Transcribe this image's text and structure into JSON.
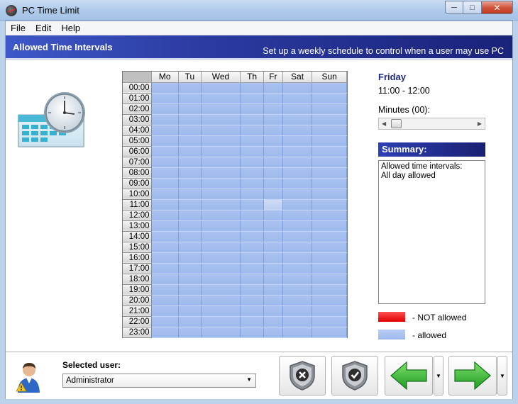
{
  "window": {
    "title": "PC Time Limit"
  },
  "window_buttons": {
    "min": "0",
    "max": "1",
    "close": "r"
  },
  "menu": {
    "items": [
      "File",
      "Edit",
      "Help"
    ]
  },
  "header": {
    "title": "Allowed Time Intervals",
    "subtitle": "Set up a weekly schedule to control when a user may use PC"
  },
  "schedule": {
    "days": [
      "Mo",
      "Tu",
      "Wed",
      "Th",
      "Fr",
      "Sat",
      "Sun"
    ],
    "hours": [
      "00:00",
      "01:00",
      "02:00",
      "03:00",
      "04:00",
      "05:00",
      "06:00",
      "07:00",
      "08:00",
      "09:00",
      "10:00",
      "11:00",
      "12:00",
      "13:00",
      "14:00",
      "15:00",
      "16:00",
      "17:00",
      "18:00",
      "19:00",
      "20:00",
      "21:00",
      "22:00",
      "23:00"
    ],
    "selected": {
      "day": "Fr",
      "hour": "11:00"
    }
  },
  "details": {
    "day": "Friday",
    "time_range": "11:00 - 12:00",
    "minutes_label": "Minutes (00):"
  },
  "summary": {
    "title": "Summary:",
    "line1": "Allowed time intervals:",
    "line2": "All day allowed"
  },
  "legend": {
    "not_allowed": "- NOT allowed",
    "allowed": "- allowed",
    "colors": {
      "not_allowed": "#ff2020",
      "allowed": "#a9c1f0"
    }
  },
  "user": {
    "label": "Selected user:",
    "value": "Administrator"
  },
  "icons": {
    "app": "clock-app-icon",
    "calendar": "calendar-clock-icon",
    "user": "user-warning-icon",
    "deny": "shield-x-icon",
    "allow": "shield-check-icon",
    "back": "green-arrow-left-icon",
    "forward": "green-arrow-right-icon"
  }
}
